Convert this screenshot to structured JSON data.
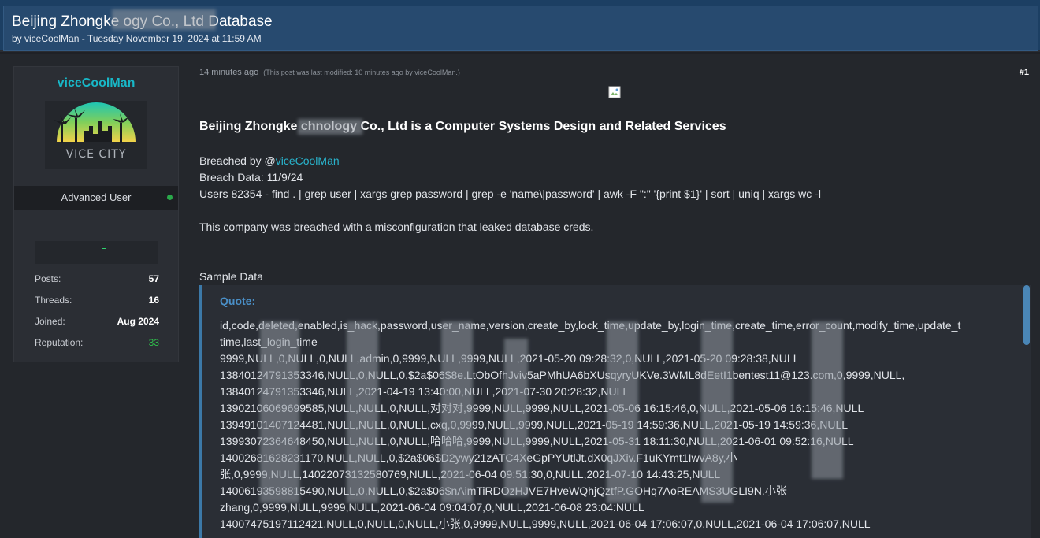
{
  "thread": {
    "title": "Beijing Zhongke                         ogy Co., Ltd Database",
    "byline": "by viceCoolMan - Tuesday November 19, 2024 at 11:59 AM"
  },
  "user": {
    "name": "viceCoolMan",
    "avatar_text": "VICE CITY",
    "title": "Advanced User",
    "stats": [
      {
        "label": "Posts:",
        "value": "57"
      },
      {
        "label": "Threads:",
        "value": "16"
      },
      {
        "label": "Joined:",
        "value": "Aug 2024"
      },
      {
        "label": "Reputation:",
        "value": "33"
      }
    ]
  },
  "post": {
    "time": "14 minutes ago",
    "modified": "(This post was last modified: 10 minutes ago by viceCoolMan.)",
    "number": "#1",
    "heading": "Beijing Zhongke               chnology Co., Ltd is a Computer Systems Design and Related Services",
    "breached_by_prefix": "Breached by @",
    "breached_by_user": "viceCoolMan",
    "breach_date": "Breach Data: 11/9/24",
    "users_line": "Users 82354 - find . | grep user | xargs grep password | grep -e 'name\\|password' | awk -F \":\" '{print $1}' | sort | uniq | xargs wc -l",
    "description": "This company was breached with a misconfiguration that leaked database creds.",
    "sample_label": "Sample Data"
  },
  "quote": {
    "label": "Quote:",
    "lines": [
      "id,code,deleted,enabled,is_hack,password,user_name,version,create_by,lock_time,update_by,login_time,create_time,error_count,modify_time,update_t",
      "time,last_login_time",
      "9999,NULL,0,NULL,0,NULL,admin,0,9999,NULL,9999,NULL,2021-05-20 09:28:32,0,NULL,2021-05-20 09:28:38,NULL",
      "13840124791353346,NULL,0,NULL,0,$2a$06$8e.LtObOfhJviv5aPMhUA6bXUsqyryUKVe.3WML8dEetI1bentest11@123.com,0,9999,NULL,",
      "13840124791353346,NULL,2021-04-19 13:40:00,NULL,2021-07-30 20:28:32,NULL",
      "13902106069699585,NULL,NULL,0,NULL,对对对,9999,NULL,9999,NULL,2021-05-06 16:15:46,0,NULL,2021-05-06 16:15:46,NULL",
      "13949101407124481,NULL,NULL,0,NULL,cxq,0,9999,NULL,9999,NULL,2021-05-19 14:59:36,NULL,2021-05-19 14:59:36,NULL",
      "13993072364648450,NULL,NULL,0,NULL,哈哈哈,9999,NULL,9999,NULL,2021-05-31 18:11:30,NULL,2021-06-01 09:52:16,NULL",
      "14002681628231170,NULL,NULL,0,$2a$06$D2ywy21zATC4XeGpPYUtlJt.dX0qJXiv.F1uKYmt1IwvA8y,小",
      "张,0,9999,NULL,14022073132580769,NULL,2021-06-04 09:51:30,0,NULL,2021-07-10 14:43:25,NULL",
      "14006193598815490,NULL,0,NULL,0,$2a$06$nAimTiRDOzHJVE7HveWQhjQztfP.GOHq7AoREAMS3UGLI9N.小张",
      "zhang,0,9999,NULL,9999,NULL,2021-06-04 09:04:07,0,NULL,2021-06-08 23:04:NULL",
      "14007475197112421,NULL,0,NULL,0,NULL,小张,0,9999,NULL,9999,NULL,2021-06-04 17:06:07,0,NULL,2021-06-04 17:06:07,NULL"
    ]
  },
  "colors": {
    "header_bg": "#274a6f",
    "username": "#18b8c8",
    "link": "#29b3cc",
    "quote_accent": "#3c79a8",
    "reputation": "#2fbf4c"
  }
}
